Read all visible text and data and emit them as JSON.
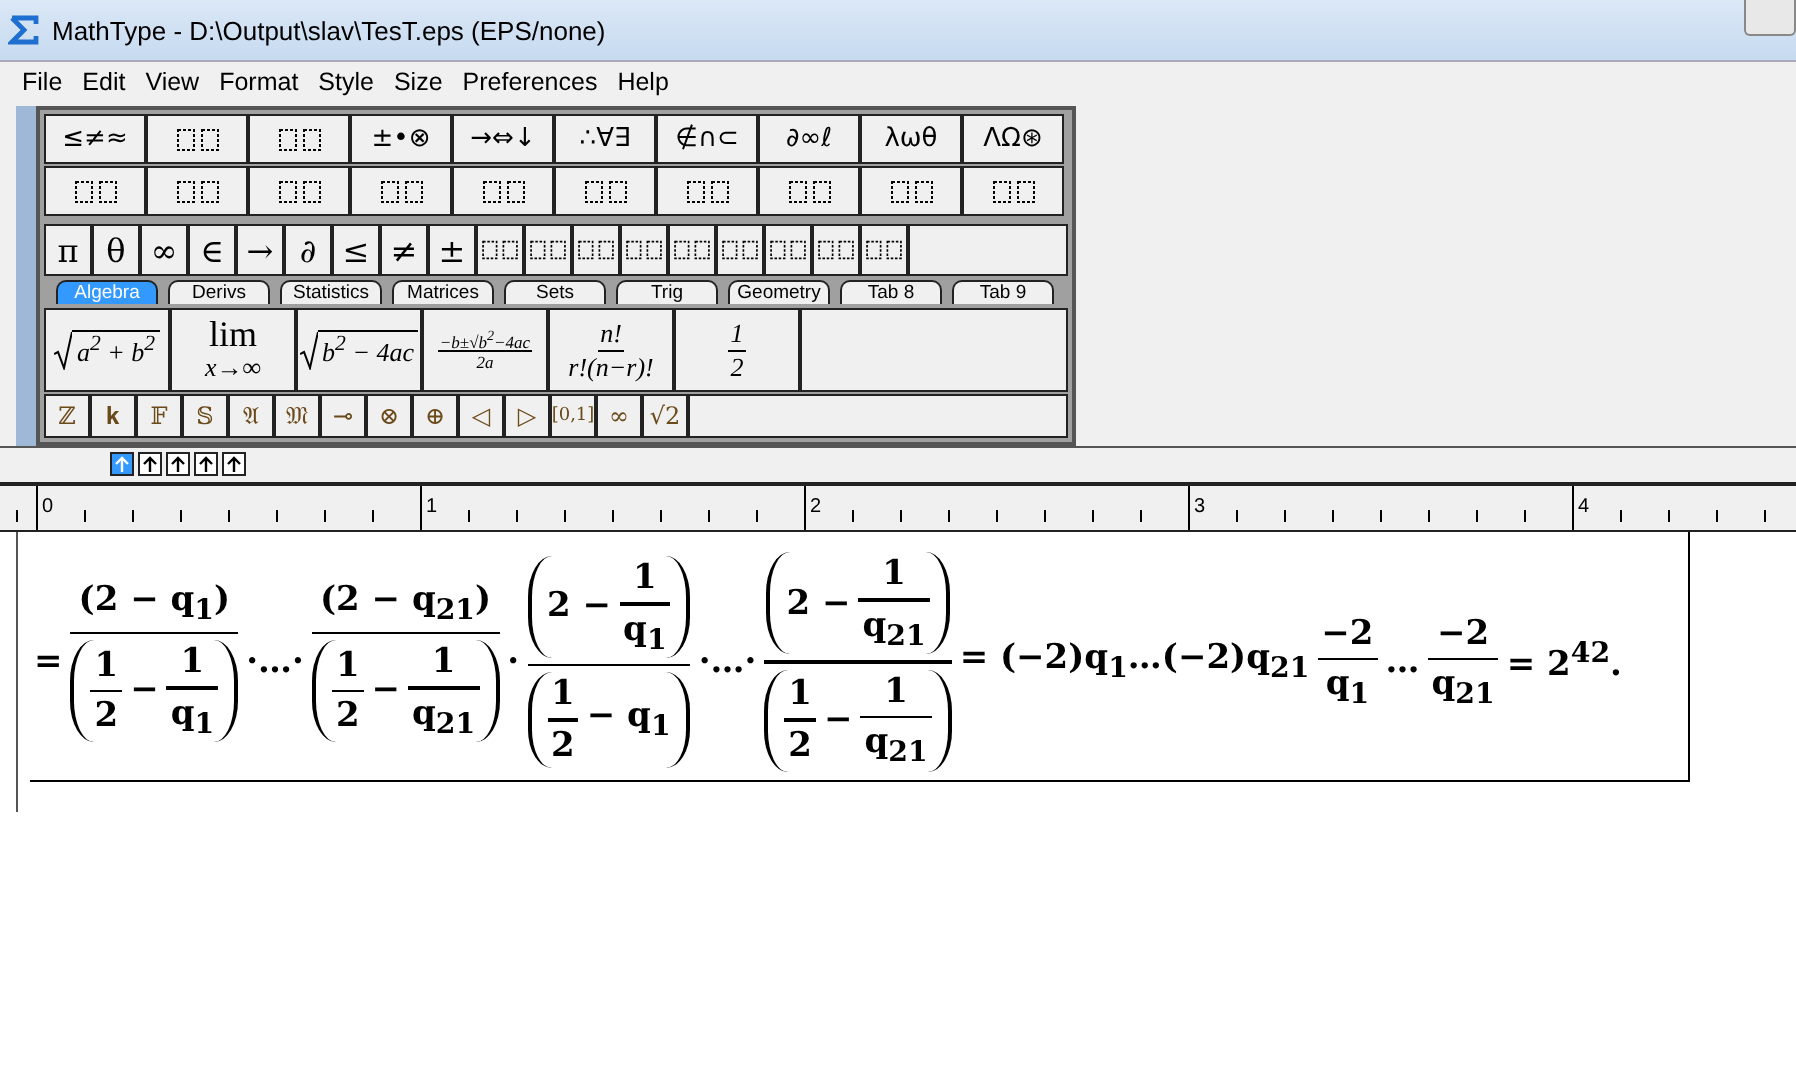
{
  "window": {
    "title": "MathType - D:\\Output\\slav\\TesT.eps (EPS/none)"
  },
  "menu": [
    "File",
    "Edit",
    "View",
    "Format",
    "Style",
    "Size",
    "Preferences",
    "Help"
  ],
  "palette_rows": [
    [
      {
        "kind": "text",
        "label": "≤≠≈"
      },
      {
        "kind": "template"
      },
      {
        "kind": "template"
      },
      {
        "kind": "text",
        "label": "±•⊗"
      },
      {
        "kind": "text",
        "label": "→⇔↓"
      },
      {
        "kind": "text",
        "label": "∴∀∃"
      },
      {
        "kind": "text",
        "label": "∉∩⊂"
      },
      {
        "kind": "text",
        "label": "∂∞ℓ"
      },
      {
        "kind": "text",
        "label": "λωθ"
      },
      {
        "kind": "text",
        "label": "ΛΩ⊛"
      }
    ],
    [
      {
        "kind": "template"
      },
      {
        "kind": "template"
      },
      {
        "kind": "template"
      },
      {
        "kind": "template"
      },
      {
        "kind": "template"
      },
      {
        "kind": "template"
      },
      {
        "kind": "template"
      },
      {
        "kind": "template"
      },
      {
        "kind": "template"
      },
      {
        "kind": "template"
      }
    ]
  ],
  "symbol_bar": [
    {
      "kind": "text",
      "label": "π"
    },
    {
      "kind": "text",
      "label": "θ"
    },
    {
      "kind": "text",
      "label": "∞"
    },
    {
      "kind": "text",
      "label": "∈"
    },
    {
      "kind": "text",
      "label": "→"
    },
    {
      "kind": "text",
      "label": "∂"
    },
    {
      "kind": "text",
      "label": "≤"
    },
    {
      "kind": "text",
      "label": "≠"
    },
    {
      "kind": "text",
      "label": "±"
    },
    {
      "kind": "template"
    },
    {
      "kind": "template"
    },
    {
      "kind": "template"
    },
    {
      "kind": "template"
    },
    {
      "kind": "template"
    },
    {
      "kind": "template"
    },
    {
      "kind": "template"
    },
    {
      "kind": "template"
    },
    {
      "kind": "template"
    }
  ],
  "tabs": [
    {
      "label": "Algebra",
      "selected": true
    },
    {
      "label": "Derivs",
      "selected": false
    },
    {
      "label": "Statistics",
      "selected": false
    },
    {
      "label": "Matrices",
      "selected": false
    },
    {
      "label": "Sets",
      "selected": false
    },
    {
      "label": "Trig",
      "selected": false
    },
    {
      "label": "Geometry",
      "selected": false
    },
    {
      "label": "Tab 8",
      "selected": false
    },
    {
      "label": "Tab 9",
      "selected": false
    }
  ],
  "tab_palette": [
    {
      "kind": "sqrt",
      "body": "a$^{2}$ + b$^{2}$"
    },
    {
      "kind": "limit",
      "top": "lim",
      "bottom": "x→∞"
    },
    {
      "kind": "sqrt",
      "body": "b$^{2}$ − 4ac"
    },
    {
      "kind": "fraction",
      "num": "−b±√b$^{2}$−4ac",
      "den": "2a"
    },
    {
      "kind": "fraction",
      "num": "n!",
      "den": "r!(n−r)!"
    },
    {
      "kind": "fraction",
      "num": "1",
      "den": "2"
    }
  ],
  "symbol_bar_2": [
    "ℤ",
    "𝐤",
    "𝔽",
    "𝕊",
    "𝔄",
    "𝔐",
    "⊸",
    "⊗",
    "⊕",
    "◁",
    "▷",
    "[0,1]",
    "∞",
    "√2"
  ],
  "nudge_buttons": [
    {
      "selected": true
    },
    {
      "selected": false
    },
    {
      "selected": false
    },
    {
      "selected": false
    },
    {
      "selected": false
    }
  ],
  "ruler": {
    "labels": [
      "0",
      "1",
      "2",
      "3",
      "4"
    ]
  },
  "equation": [
    {
      "kind": "text",
      "text": "="
    },
    {
      "kind": "fraction",
      "numerator": [
        {
          "kind": "text",
          "text": "(2 − q$_{1}$)"
        }
      ],
      "denominator": [
        {
          "kind": "parens",
          "body": [
            {
              "kind": "fraction",
              "numerator": [
                {
                  "kind": "text",
                  "text": "1"
                }
              ],
              "denominator": [
                {
                  "kind": "text",
                  "text": "2"
                }
              ]
            },
            {
              "kind": "text",
              "text": "−"
            },
            {
              "kind": "fraction",
              "numerator": [
                {
                  "kind": "text",
                  "text": "1"
                }
              ],
              "denominator": [
                {
                  "kind": "text",
                  "text": "q$_{1}$"
                }
              ]
            }
          ]
        }
      ]
    },
    {
      "kind": "text",
      "text": "·…·"
    },
    {
      "kind": "fraction",
      "numerator": [
        {
          "kind": "text",
          "text": "(2 − q$_{21}$)"
        }
      ],
      "denominator": [
        {
          "kind": "parens",
          "body": [
            {
              "kind": "fraction",
              "numerator": [
                {
                  "kind": "text",
                  "text": "1"
                }
              ],
              "denominator": [
                {
                  "kind": "text",
                  "text": "2"
                }
              ]
            },
            {
              "kind": "text",
              "text": "−"
            },
            {
              "kind": "fraction",
              "numerator": [
                {
                  "kind": "text",
                  "text": "1"
                }
              ],
              "denominator": [
                {
                  "kind": "text",
                  "text": "q$_{21}$"
                }
              ]
            }
          ]
        }
      ]
    },
    {
      "kind": "text",
      "text": "·"
    },
    {
      "kind": "fraction",
      "numerator": [
        {
          "kind": "parens",
          "body": [
            {
              "kind": "text",
              "text": "2 −"
            },
            {
              "kind": "fraction",
              "numerator": [
                {
                  "kind": "text",
                  "text": "1"
                }
              ],
              "denominator": [
                {
                  "kind": "text",
                  "text": "q$_{1}$"
                }
              ]
            }
          ]
        }
      ],
      "denominator": [
        {
          "kind": "parens",
          "body": [
            {
              "kind": "fraction",
              "numerator": [
                {
                  "kind": "text",
                  "text": "1"
                }
              ],
              "denominator": [
                {
                  "kind": "text",
                  "text": "2"
                }
              ]
            },
            {
              "kind": "text",
              "text": "− q$_{1}$"
            }
          ]
        }
      ]
    },
    {
      "kind": "text",
      "text": "·…·"
    },
    {
      "kind": "fraction",
      "numerator": [
        {
          "kind": "parens",
          "body": [
            {
              "kind": "text",
              "text": "2 −"
            },
            {
              "kind": "fraction",
              "numerator": [
                {
                  "kind": "text",
                  "text": "1"
                }
              ],
              "denominator": [
                {
                  "kind": "text",
                  "text": "q$_{21}$"
                }
              ]
            }
          ]
        }
      ],
      "denominator": [
        {
          "kind": "parens",
          "body": [
            {
              "kind": "fraction",
              "numerator": [
                {
                  "kind": "text",
                  "text": "1"
                }
              ],
              "denominator": [
                {
                  "kind": "text",
                  "text": "2"
                }
              ]
            },
            {
              "kind": "text",
              "text": "−"
            },
            {
              "kind": "fraction",
              "numerator": [
                {
                  "kind": "text",
                  "text": "1"
                }
              ],
              "denominator": [
                {
                  "kind": "text",
                  "text": "q$_{21}$"
                }
              ]
            }
          ]
        }
      ]
    },
    {
      "kind": "text",
      "text": "= (−2)q$_{1}$…(−2)q$_{21}$"
    },
    {
      "kind": "fraction",
      "numerator": [
        {
          "kind": "text",
          "text": "−2"
        }
      ],
      "denominator": [
        {
          "kind": "text",
          "text": "q$_{1}$"
        }
      ]
    },
    {
      "kind": "text",
      "text": "…"
    },
    {
      "kind": "fraction",
      "numerator": [
        {
          "kind": "text",
          "text": "−2"
        }
      ],
      "denominator": [
        {
          "kind": "text",
          "text": "q$_{21}$"
        }
      ]
    },
    {
      "kind": "text",
      "text": "= 2$^{42}$."
    }
  ]
}
